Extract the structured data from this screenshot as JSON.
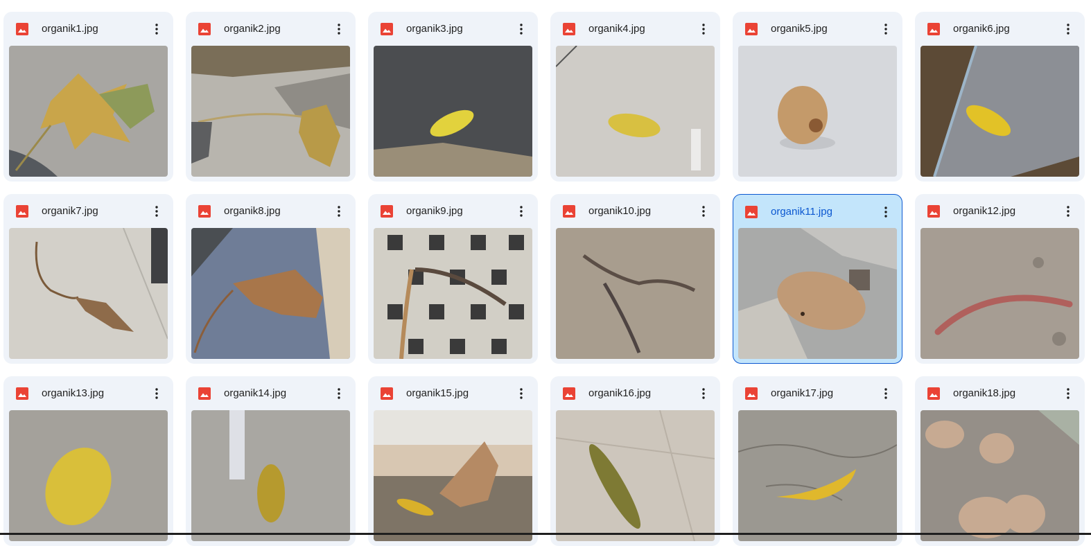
{
  "files": [
    {
      "name": "organik1.jpg"
    },
    {
      "name": "organik2.jpg"
    },
    {
      "name": "organik3.jpg"
    },
    {
      "name": "organik4.jpg"
    },
    {
      "name": "organik5.jpg"
    },
    {
      "name": "organik6.jpg"
    },
    {
      "name": "organik7.jpg"
    },
    {
      "name": "organik8.jpg"
    },
    {
      "name": "organik9.jpg"
    },
    {
      "name": "organik10.jpg"
    },
    {
      "name": "organik11.jpg",
      "selected": true
    },
    {
      "name": "organik12.jpg"
    },
    {
      "name": "organik13.jpg"
    },
    {
      "name": "organik14.jpg"
    },
    {
      "name": "organik15.jpg"
    },
    {
      "name": "organik16.jpg"
    },
    {
      "name": "organik17.jpg"
    },
    {
      "name": "organik18.jpg"
    }
  ],
  "icons": {
    "file_type": "image-file-icon",
    "more": "more-vert-icon"
  },
  "colors": {
    "card_bg": "#eff3f9",
    "selected_bg": "#c3e5fb",
    "selected_border": "#0b57d0",
    "image_icon": "#ea4335"
  }
}
